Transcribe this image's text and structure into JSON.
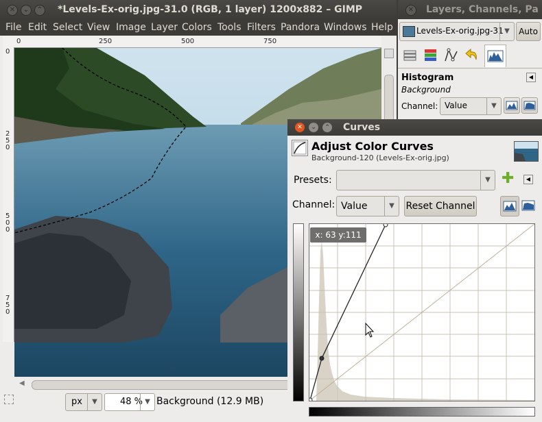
{
  "main_window": {
    "title": "*Levels-Ex-orig.jpg-31.0 (RGB, 1 layer) 1200x882 – GIMP",
    "menu": [
      "File",
      "Edit",
      "Select",
      "View",
      "Image",
      "Layer",
      "Colors",
      "Tools",
      "Filters",
      "Pandora",
      "Windows",
      "Help"
    ],
    "ruler_top_labels": [
      "0",
      "250",
      "500",
      "750"
    ],
    "ruler_left_labels": [
      "0",
      "2\n5\n0",
      "5\n0\n0",
      "7\n5\n0"
    ],
    "status": {
      "unit": "px",
      "zoom": "48 %",
      "layer_info": "Background (12.9 MB)"
    }
  },
  "dock": {
    "title": "Layers, Channels, Pa",
    "image_selector": "Levels-Ex-orig.jpg-31",
    "auto_label": "Auto",
    "tab_icons": [
      "layers-icon",
      "channels-icon",
      "paths-icon",
      "undo-icon",
      "histogram-icon"
    ],
    "histogram_heading": "Histogram",
    "histogram_layer": "Background",
    "channel_label": "Channel:",
    "channel_value": "Value"
  },
  "curves_dialog": {
    "title": "Curves",
    "heading": "Adjust Color Curves",
    "subheading": "Background-120 (Levels-Ex-orig.jpg)",
    "presets_label": "Presets:",
    "presets_value": "",
    "channel_label": "Channel:",
    "channel_value": "Value",
    "reset_channel_label": "Reset Channel",
    "cursor_readout": "x: 63 y:111"
  },
  "colors": {
    "titlebar": "#3c3b37",
    "close_orange": "#e2561f",
    "panel_bg": "#edeceb",
    "histogram_fill": "#d9d2c7",
    "grid": "#c8c2b5"
  }
}
